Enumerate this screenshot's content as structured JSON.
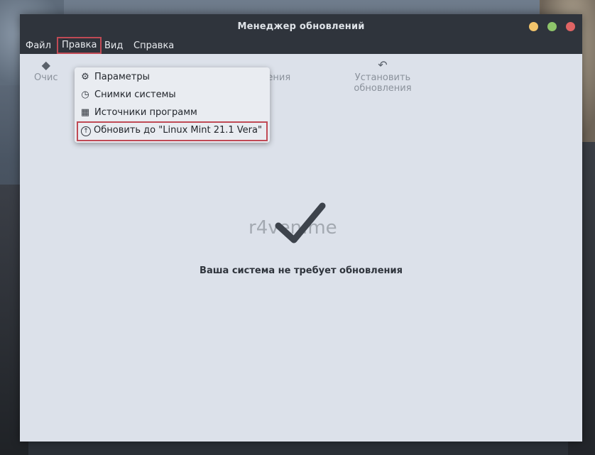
{
  "window": {
    "title": "Менеджер обновлений"
  },
  "menubar": {
    "file": "Файл",
    "edit": "Правка",
    "view": "Вид",
    "help": "Справка"
  },
  "toolbar": {
    "clear_partial": "Очис",
    "refresh_partial": "обновления",
    "install": "Установить обновления"
  },
  "dropdown": {
    "items": [
      {
        "label": "Параметры",
        "icon": "preferences-icon"
      },
      {
        "label": "Снимки системы",
        "icon": "clock-icon"
      },
      {
        "label": "Источники программ",
        "icon": "software-sources-icon"
      },
      {
        "label": "Обновить до \"Linux Mint 21.1 Vera\"",
        "icon": "upgrade-arrow-icon"
      }
    ]
  },
  "status": {
    "message": "Ваша система не требует обновления"
  },
  "watermark": "r4ven.me",
  "colors": {
    "titlebar": "#2f343c",
    "content_bg": "#dce1ea",
    "highlight_border": "#c04a55",
    "minimize": "#f2c46b",
    "maximize": "#8ec46a",
    "close": "#e06464"
  }
}
